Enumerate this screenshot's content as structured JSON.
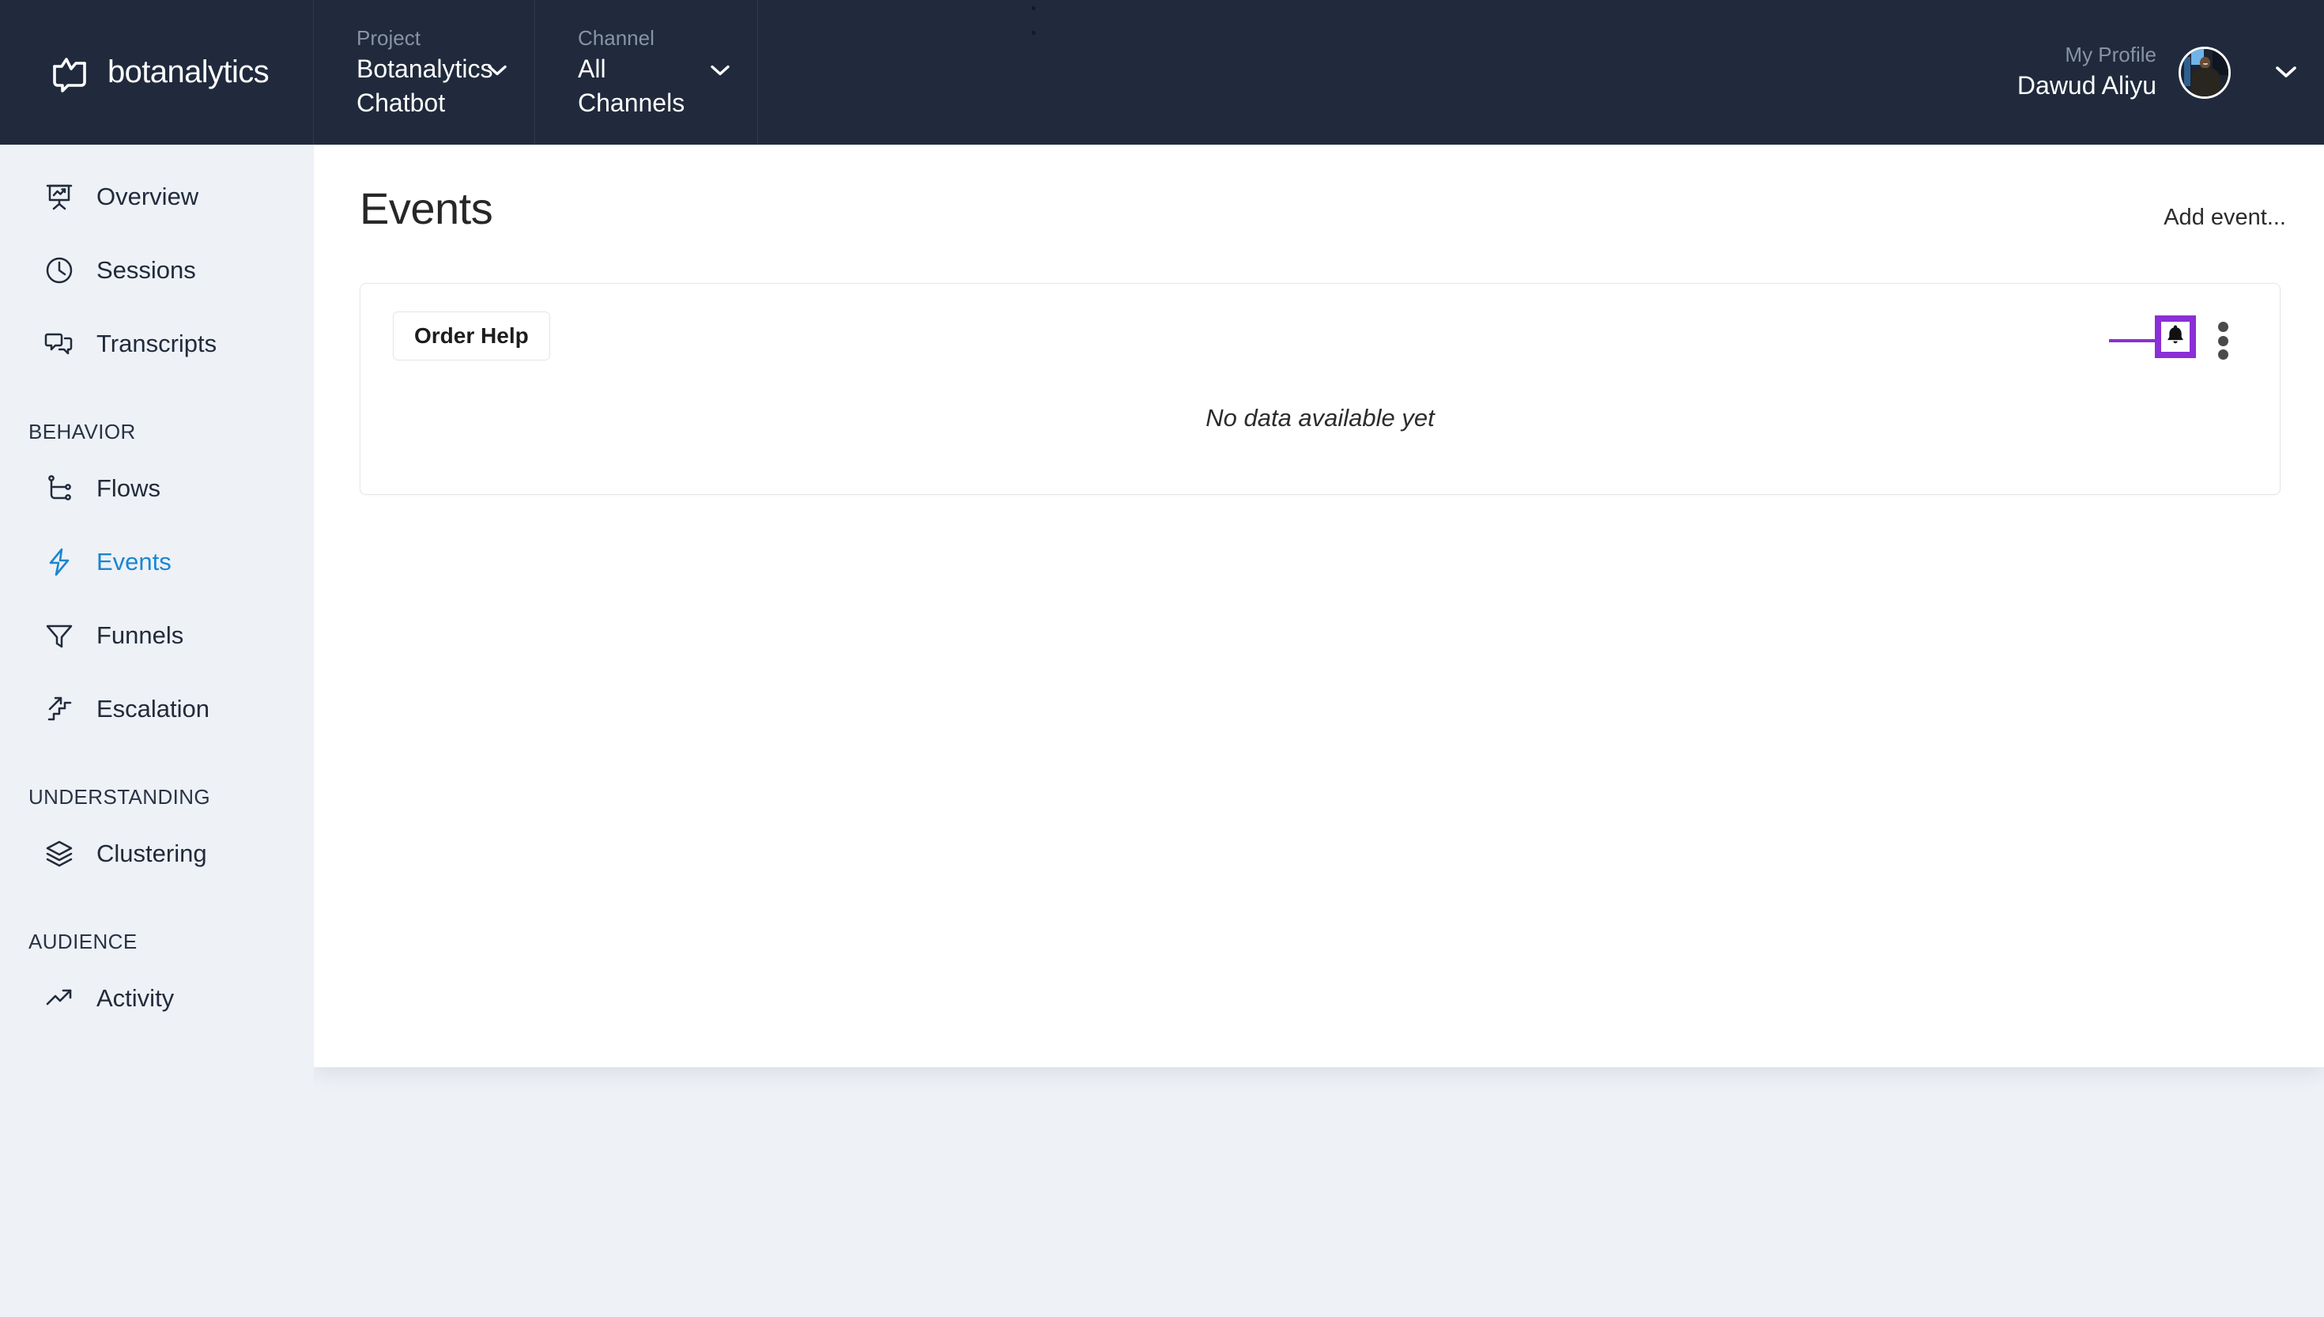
{
  "brand": {
    "name": "botanalytics",
    "logo_icon": "speech-bubble-chart-logo"
  },
  "topbar": {
    "project": {
      "label": "Project",
      "value": "Botanalytics Chatbot",
      "chevron_icon": "chevron-down-icon"
    },
    "channel": {
      "label": "Channel",
      "value": "All Channels",
      "chevron_icon": "chevron-down-icon"
    },
    "profile": {
      "label": "My Profile",
      "name": "Dawud Aliyu",
      "avatar_icon": "user-avatar-photo",
      "chevron_icon": "chevron-down-icon"
    },
    "window_handle_icon": "drag-handle-dots-icon",
    "background_color": "#202a3c"
  },
  "sidebar": {
    "background_color": "#eef1f6",
    "active_color": "#1a86d0",
    "groups": [
      {
        "heading": null,
        "items": [
          {
            "label": "Overview",
            "icon": "presentation-chart-icon",
            "active": false
          },
          {
            "label": "Sessions",
            "icon": "clock-icon",
            "active": false
          },
          {
            "label": "Transcripts",
            "icon": "chat-bubbles-icon",
            "active": false
          }
        ]
      },
      {
        "heading": "BEHAVIOR",
        "items": [
          {
            "label": "Flows",
            "icon": "flow-branch-icon",
            "active": false
          },
          {
            "label": "Events",
            "icon": "lightning-bolt-icon",
            "active": true
          },
          {
            "label": "Funnels",
            "icon": "funnel-icon",
            "active": false
          },
          {
            "label": "Escalation",
            "icon": "stairs-arrow-icon",
            "active": false
          }
        ]
      },
      {
        "heading": "UNDERSTANDING",
        "items": [
          {
            "label": "Clustering",
            "icon": "layers-stack-icon",
            "active": false
          }
        ]
      },
      {
        "heading": "AUDIENCE",
        "items": [
          {
            "label": "Activity",
            "icon": "trending-up-arrow-icon",
            "active": false
          }
        ]
      }
    ]
  },
  "main": {
    "title": "Events",
    "add_event_label": "Add event...",
    "card": {
      "event_name": "Order Help",
      "empty_state": "No data available yet",
      "alert_icon": "bell-icon",
      "alert_glyph": "🔔",
      "kebab_icon": "more-vertical-icon",
      "highlight_color": "#8b2fd6",
      "annotation_icon": "arrow-right-annotation"
    }
  }
}
